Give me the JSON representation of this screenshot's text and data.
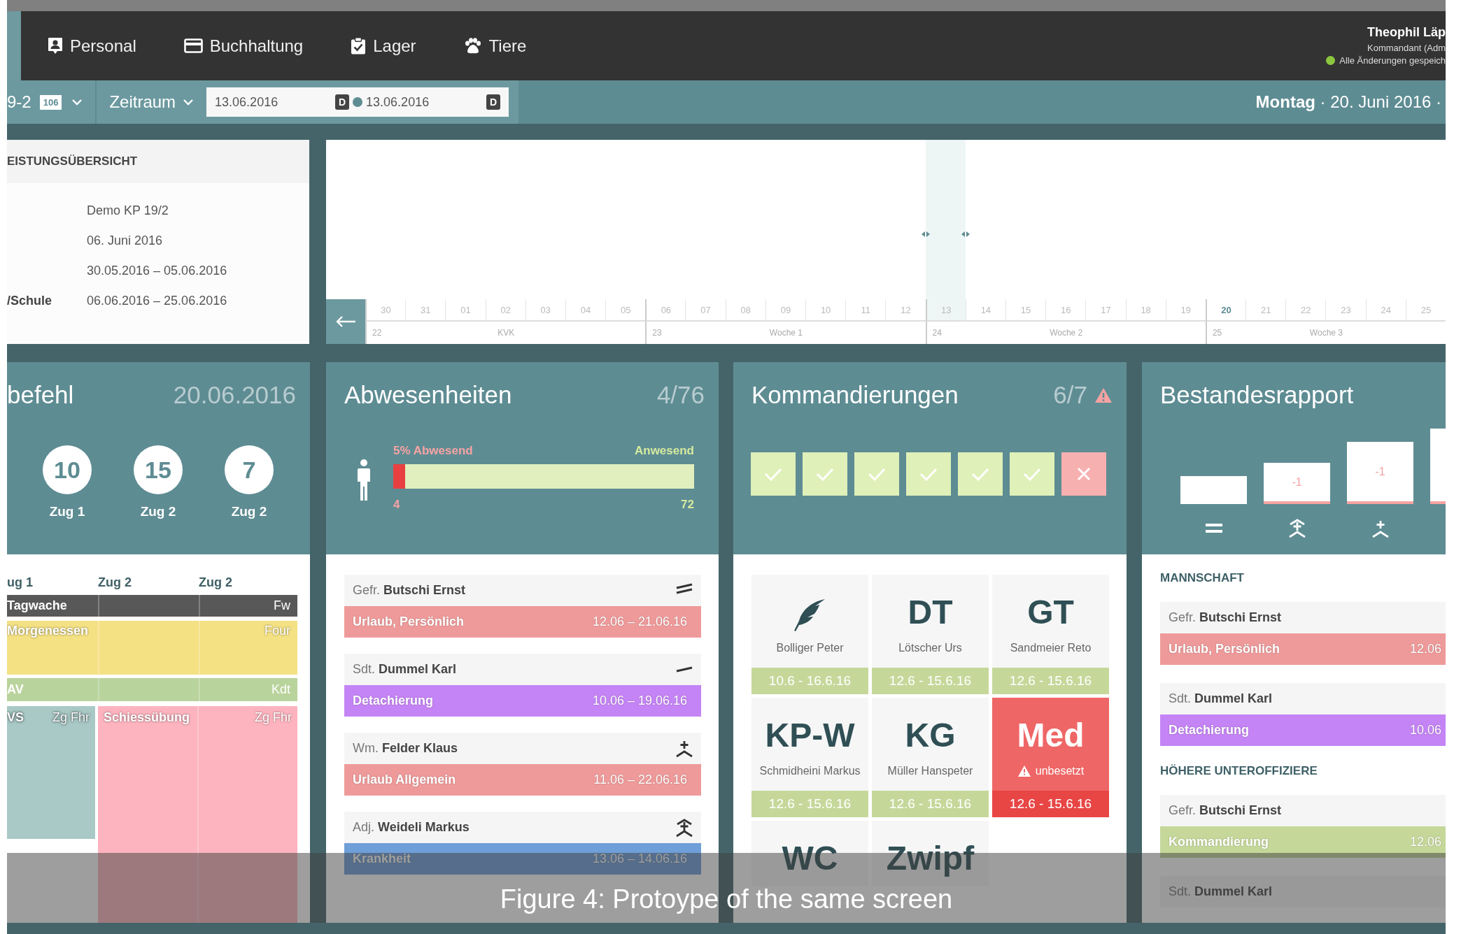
{
  "nav": {
    "items": [
      {
        "label": "Personal"
      },
      {
        "label": "Buchhaltung"
      },
      {
        "label": "Lager"
      },
      {
        "label": "Tiere"
      }
    ],
    "user": {
      "name": "Theophil Läp",
      "role": "Kommandant (Adm",
      "status": "Alle Änderungen gespeich",
      "saved": true
    }
  },
  "toolbar": {
    "unit": "9-2",
    "badge": "106",
    "period": "Zeitraum",
    "dates": [
      {
        "value": "13.06.2016",
        "picker": "D"
      },
      {
        "value": "13.06.2016",
        "picker": "D"
      }
    ],
    "day": "**Montag** · 20. Juni 2016 ·"
  },
  "overview": {
    "title": "EISTUNGSÜBERSICHT",
    "rows": [
      {
        "value": "Demo KP 19/2"
      },
      {
        "value": "06. Juni 2016"
      },
      {
        "value": "30.05.2016 – 05.06.2016"
      },
      {
        "label": "/Schule",
        "value": "06.06.2016 – 25.06.2016"
      }
    ]
  },
  "timeline": {
    "days": [
      {
        "label": "30",
        "selected": false,
        "today": false,
        "week_start": true
      },
      {
        "label": "31",
        "selected": false,
        "today": false,
        "week_start": false
      },
      {
        "label": "01",
        "selected": false,
        "today": false,
        "week_start": false
      },
      {
        "label": "02",
        "selected": false,
        "today": false,
        "week_start": false
      },
      {
        "label": "03",
        "selected": false,
        "today": false,
        "week_start": false
      },
      {
        "label": "04",
        "selected": false,
        "today": false,
        "week_start": false
      },
      {
        "label": "05",
        "selected": false,
        "today": false,
        "week_start": false
      },
      {
        "label": "06",
        "selected": false,
        "today": false,
        "week_start": true
      },
      {
        "label": "07",
        "selected": false,
        "today": false,
        "week_start": false
      },
      {
        "label": "08",
        "selected": false,
        "today": false,
        "week_start": false
      },
      {
        "label": "09",
        "selected": false,
        "today": false,
        "week_start": false
      },
      {
        "label": "10",
        "selected": false,
        "today": false,
        "week_start": false
      },
      {
        "label": "11",
        "selected": false,
        "today": false,
        "week_start": false
      },
      {
        "label": "12",
        "selected": false,
        "today": false,
        "week_start": false
      },
      {
        "label": "13",
        "selected": true,
        "today": false,
        "week_start": true
      },
      {
        "label": "14",
        "selected": false,
        "today": false,
        "week_start": false
      },
      {
        "label": "15",
        "selected": false,
        "today": false,
        "week_start": false
      },
      {
        "label": "16",
        "selected": false,
        "today": false,
        "week_start": false
      },
      {
        "label": "17",
        "selected": false,
        "today": false,
        "week_start": false
      },
      {
        "label": "18",
        "selected": false,
        "today": false,
        "week_start": false
      },
      {
        "label": "19",
        "selected": false,
        "today": false,
        "week_start": false
      },
      {
        "label": "20",
        "selected": false,
        "today": true,
        "week_start": true
      },
      {
        "label": "21",
        "selected": false,
        "today": false,
        "week_start": false
      },
      {
        "label": "22",
        "selected": false,
        "today": false,
        "week_start": false
      },
      {
        "label": "23",
        "selected": false,
        "today": false,
        "week_start": false
      },
      {
        "label": "24",
        "selected": false,
        "today": false,
        "week_start": false
      },
      {
        "label": "25",
        "selected": false,
        "today": false,
        "week_start": false
      }
    ],
    "weeks": [
      {
        "number": "22",
        "label": "KVK"
      },
      {
        "number": "23",
        "label": "Woche 1"
      },
      {
        "number": "24",
        "label": "Woche 2"
      },
      {
        "number": "25",
        "label": "Woche 3"
      }
    ]
  },
  "duty": {
    "title": "befehl",
    "date": "20.06.2016",
    "counts": [
      {
        "value": "10",
        "label": "Zug 1"
      },
      {
        "value": "15",
        "label": "Zug 2"
      },
      {
        "value": "7",
        "label": "Zug 2"
      }
    ],
    "columns": [
      "ug 1",
      "Zug 2",
      "Zug 2"
    ],
    "rows": [
      {
        "kind": "full",
        "title": "Tagwache",
        "person": "Fw",
        "color": "#585858"
      },
      {
        "kind": "full",
        "title": "Morgenessen",
        "person": "Four",
        "color": "#f4e184"
      },
      {
        "kind": "full",
        "title": "AV",
        "person": "Kdt",
        "color": "#b9d39c"
      },
      {
        "kind": "split",
        "blocks": [
          {
            "title": "VS",
            "person": "Zg Fhr",
            "color": "#a9c9c6"
          },
          {
            "title": "Schiessübung",
            "person": "Zg Fhr",
            "color": "#fdb4bf"
          }
        ]
      }
    ]
  },
  "absences": {
    "title": "Abwesenheiten",
    "count": "4/76",
    "absent_label": "5% Abwesend",
    "present_label": "Anwesend",
    "absent_count": "4",
    "present_count": "72",
    "level": 0.04,
    "entries": [
      {
        "person": "Gefr. **Butschi Ernst**",
        "kind": "two-bars",
        "reason": "Urlaub, Persönlich",
        "dates": "12.06 – 21.06.16",
        "color": "#ef9a9a"
      },
      {
        "person": "Sdt. **Dummel Karl**",
        "kind": "one-bar",
        "reason": "Detachierung",
        "dates": "10.06 – 19.06.16",
        "color": "#c484f5"
      },
      {
        "person": "Wm. **Felder Klaus**",
        "kind": "one-chevron",
        "reason": "Urlaub Allgemein",
        "dates": "11.06 – 22.06.16",
        "color": "#ef9a9a"
      },
      {
        "person": "Adj. **Weideli Markus**",
        "kind": "two-chevrons",
        "reason": "Krankheit",
        "dates": "13.06 – 14.06.16",
        "color": "#6f9fd8"
      }
    ]
  },
  "assignments": {
    "title": "Kommandierungen",
    "count": "6/7",
    "warning": true,
    "checks": [
      {
        "ok": true
      },
      {
        "ok": true
      },
      {
        "ok": true
      },
      {
        "ok": true
      },
      {
        "ok": true
      },
      {
        "ok": true
      },
      {
        "ok": false
      }
    ],
    "tiles": [
      {
        "kind": "icon",
        "name": "Bolliger Peter",
        "dates": "10.6 - 16.6.16",
        "vacant": false
      },
      {
        "kind": "code",
        "code": "DT",
        "name": "Lötscher Urs",
        "dates": "12.6 - 15.6.16",
        "vacant": false
      },
      {
        "kind": "code",
        "code": "GT",
        "name": "Sandmeier Reto",
        "dates": "12.6 - 15.6.16",
        "vacant": false
      },
      {
        "kind": "code",
        "code": "KP-W",
        "name": "Schmidheini Markus",
        "dates": "12.6 - 15.6.16",
        "vacant": false
      },
      {
        "kind": "code",
        "code": "KG",
        "name": "Müller Hanspeter",
        "dates": "12.6 - 15.6.16",
        "vacant": false
      },
      {
        "kind": "code",
        "code": "Med",
        "name": "unbesetzt",
        "dates": "12.6 - 15.6.16",
        "vacant": true
      },
      {
        "kind": "code",
        "code": "WC",
        "vacant": false
      },
      {
        "kind": "code",
        "code": "Zwipf",
        "vacant": false
      }
    ]
  },
  "roster": {
    "title": "Bestandesrapport",
    "bars": [
      {
        "kind": "equal",
        "deficit": false
      },
      {
        "label": "-1",
        "kind": "two-chevrons",
        "deficit": true
      },
      {
        "label": "-1",
        "kind": "one-chevron",
        "deficit": true
      },
      {
        "deficit": true
      }
    ],
    "sections": [
      {
        "title": "MANNSCHAFT",
        "entries": [
          {
            "person": "Gefr. **Butschi Ernst**",
            "reason": "Urlaub, Persönlich",
            "dates": "12.06",
            "color": "#ef9a9a"
          },
          {
            "person": "Sdt. **Dummel Karl**",
            "reason": "Detachierung",
            "dates": "10.06",
            "color": "#c484f5"
          }
        ]
      },
      {
        "title": "HÖHERE UNTEROFFIZIERE",
        "entries": [
          {
            "person": "Gefr. **Butschi Ernst**",
            "reason": "Kommandierung",
            "dates": "12.06",
            "color": "#c5d89a"
          },
          {
            "person": "Sdt. **Dummel Karl**"
          }
        ]
      }
    ]
  },
  "caption": "Figure 4: Protoype of the same screen"
}
